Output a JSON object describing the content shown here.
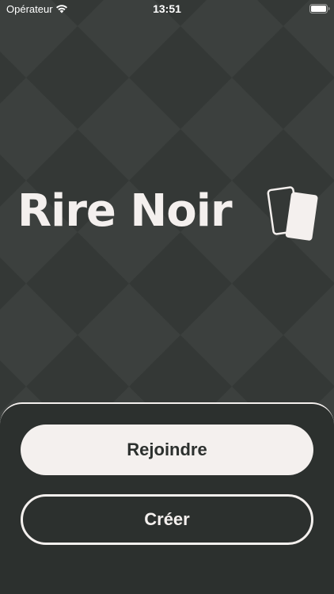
{
  "status_bar": {
    "carrier": "Opérateur",
    "time": "13:51",
    "wifi_icon": "wifi-icon",
    "battery_icon": "battery-icon"
  },
  "logo": {
    "text": "Rire Noir",
    "icon": "cards-icon"
  },
  "actions": {
    "join_label": "Rejoindre",
    "create_label": "Créer"
  },
  "colors": {
    "background": "#343836",
    "diamond": "#3b3f3d",
    "panel": "#2c302e",
    "foreground": "#f4f0ee"
  }
}
